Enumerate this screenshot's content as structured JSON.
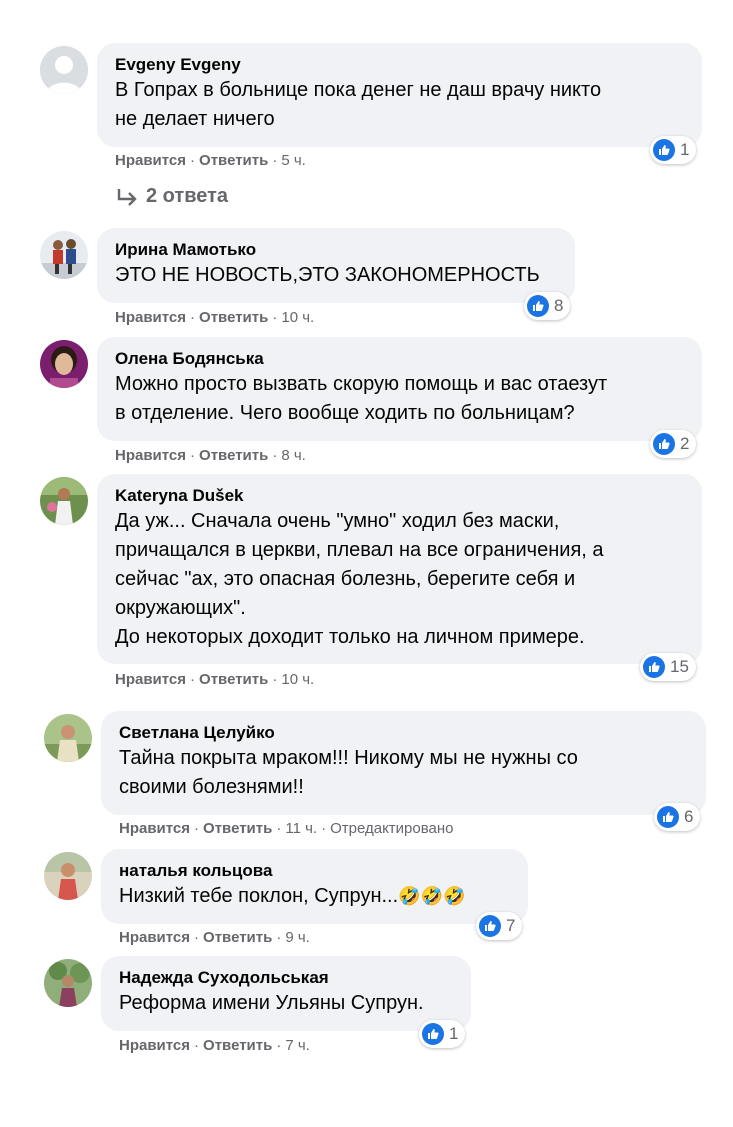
{
  "comments": [
    {
      "author": "Evgeny Evgeny",
      "text": "В Гопрах в больнице пока денег не даш врачу никто\nне делает ничего",
      "reactions": "1",
      "like_label": "Нравится",
      "reply_label": "Ответить",
      "time": "5 ч.",
      "avatar": "default-silhouette"
    },
    {
      "author": "Ирина Мамотько",
      "text": "ЭТО НЕ НОВОСТЬ,ЭТО ЗАКОНОМЕРНОСТЬ",
      "reactions": "8",
      "like_label": "Нравится",
      "reply_label": "Ответить",
      "time": "10 ч.",
      "avatar": "photo"
    },
    {
      "author": "Олена Бодянська",
      "text": "Можно просто вызвать скорую помощь и вас отаезут\nв отделение. Чего вообще ходить по больницам?",
      "reactions": "2",
      "like_label": "Нравится",
      "reply_label": "Ответить",
      "time": "8 ч.",
      "avatar": "photo"
    },
    {
      "author": "Kateryna Dušek",
      "text": "Да уж... Сначала очень \"умно\" ходил без маски,\nпричащался в церкви, плевал на все ограничения, а\nсейчас \"ах, это опасная болезнь, берегите себя и\nокружающих\".\nДо некоторых доходит только на личном примере.",
      "reactions": "15",
      "like_label": "Нравится",
      "reply_label": "Ответить",
      "time": "10 ч.",
      "avatar": "photo"
    },
    {
      "author": "Светлана Целуйко",
      "text": "Тайна покрыта мраком!!! Никому мы не нужны со\nсвоими болезнями!!",
      "reactions": "6",
      "like_label": "Нравится",
      "reply_label": "Ответить",
      "time": "11 ч.",
      "edited": "Отредактировано",
      "avatar": "photo"
    },
    {
      "author": "наталья кольцова",
      "text": "Низкий тебе поклон, Супрун...",
      "emoji": "🤣🤣🤣",
      "reactions": "7",
      "like_label": "Нравится",
      "reply_label": "Ответить",
      "time": "9 ч.",
      "avatar": "photo"
    },
    {
      "author": "Надежда Суходольськая",
      "text": "Реформа имени Ульяны Супрун.",
      "reactions": "1",
      "like_label": "Нравится",
      "reply_label": "Ответить",
      "time": "7 ч.",
      "avatar": "photo"
    }
  ],
  "replies_link": "2 ответа",
  "colors": {
    "bubble": "#f0f2f5",
    "like_blue": "#1b74e4",
    "meta_gray": "#65676b",
    "text": "#050505"
  }
}
